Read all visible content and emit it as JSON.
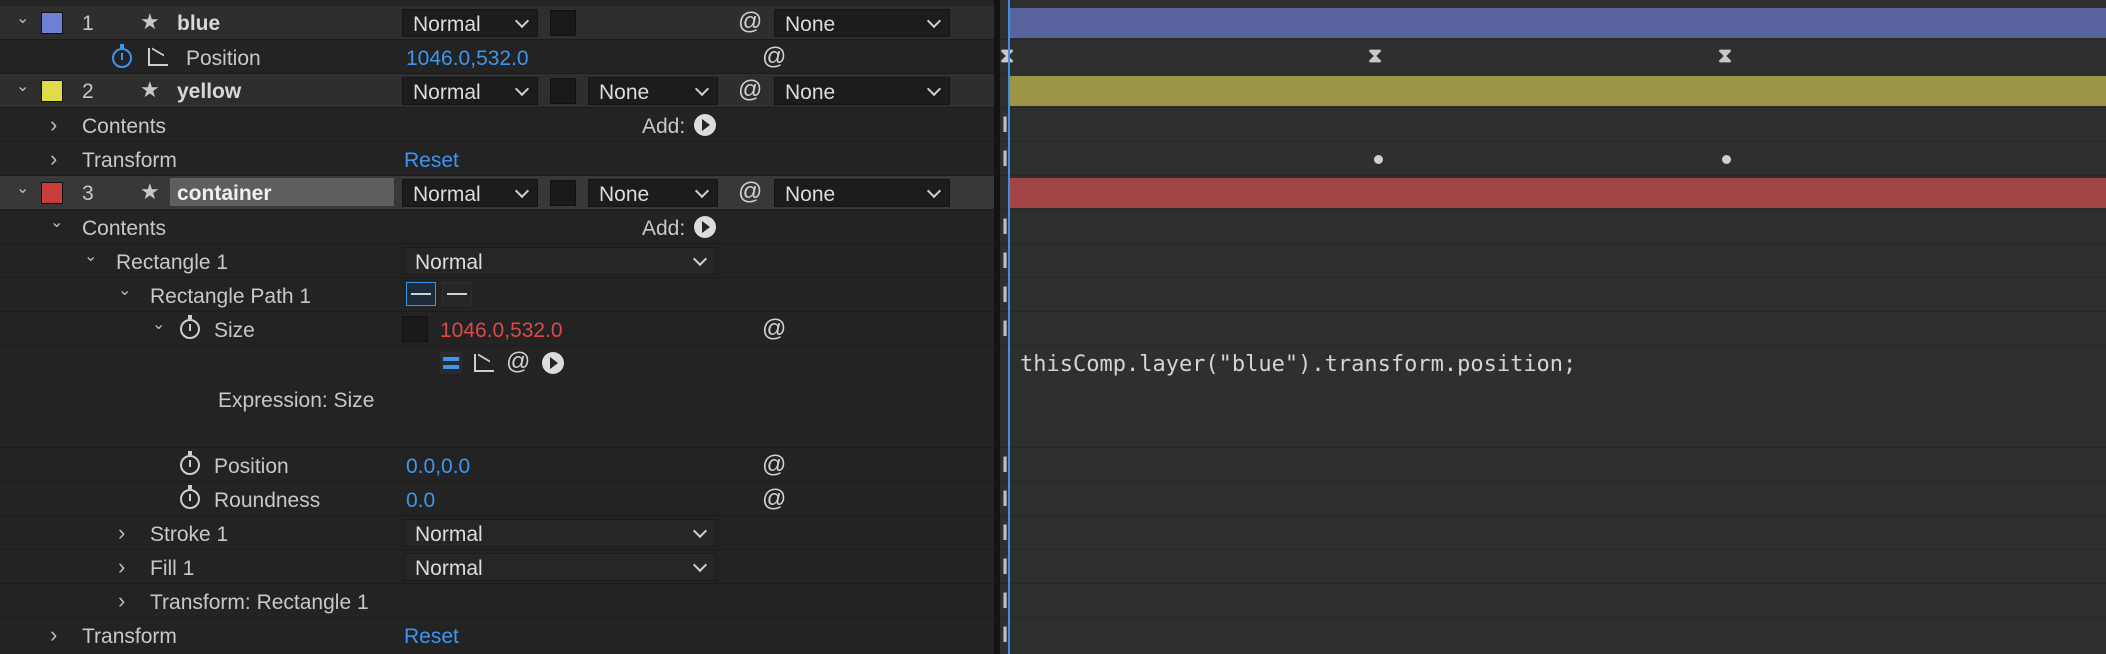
{
  "layers": [
    {
      "number": "1",
      "name": "blue",
      "color": "#6f7fd6",
      "mode": "Normal",
      "parent": "None",
      "bar_color": "#58629c"
    },
    {
      "number": "2",
      "name": "yellow",
      "color": "#e3da4a",
      "mode": "Normal",
      "trkmat": "None",
      "parent": "None",
      "bar_color": "#9a9444"
    },
    {
      "number": "3",
      "name": "container",
      "color": "#c83c3c",
      "mode": "Normal",
      "trkmat": "None",
      "parent": "None",
      "bar_color": "#a24344"
    }
  ],
  "props": {
    "position_label": "Position",
    "position_value": "1046.0,532.0",
    "contents_label": "Contents",
    "add_label": "Add:",
    "transform_label": "Transform",
    "reset_label": "Reset",
    "rectangle1_label": "Rectangle 1",
    "rectangle1_mode": "Normal",
    "rectpath_label": "Rectangle Path 1",
    "size_label": "Size",
    "size_value": "1046.0,532.0",
    "expression_label": "Expression: Size",
    "rect_position_label": "Position",
    "rect_position_value": "0.0,0.0",
    "roundness_label": "Roundness",
    "roundness_value": "0.0",
    "stroke_label": "Stroke 1",
    "stroke_mode": "Normal",
    "fill_label": "Fill 1",
    "fill_mode": "Normal",
    "transform_rect_label": "Transform: Rectangle 1",
    "transform2_label": "Transform",
    "reset2_label": "Reset"
  },
  "timeline": {
    "expression": "thisComp.layer(\"blue\").transform.position;",
    "keyframe_glyph": "⧗",
    "ibeam_glyph": "I"
  },
  "icons": {
    "star": "★",
    "spiral": "@",
    "chevron_right": "›",
    "chevron_down": "⌄"
  }
}
